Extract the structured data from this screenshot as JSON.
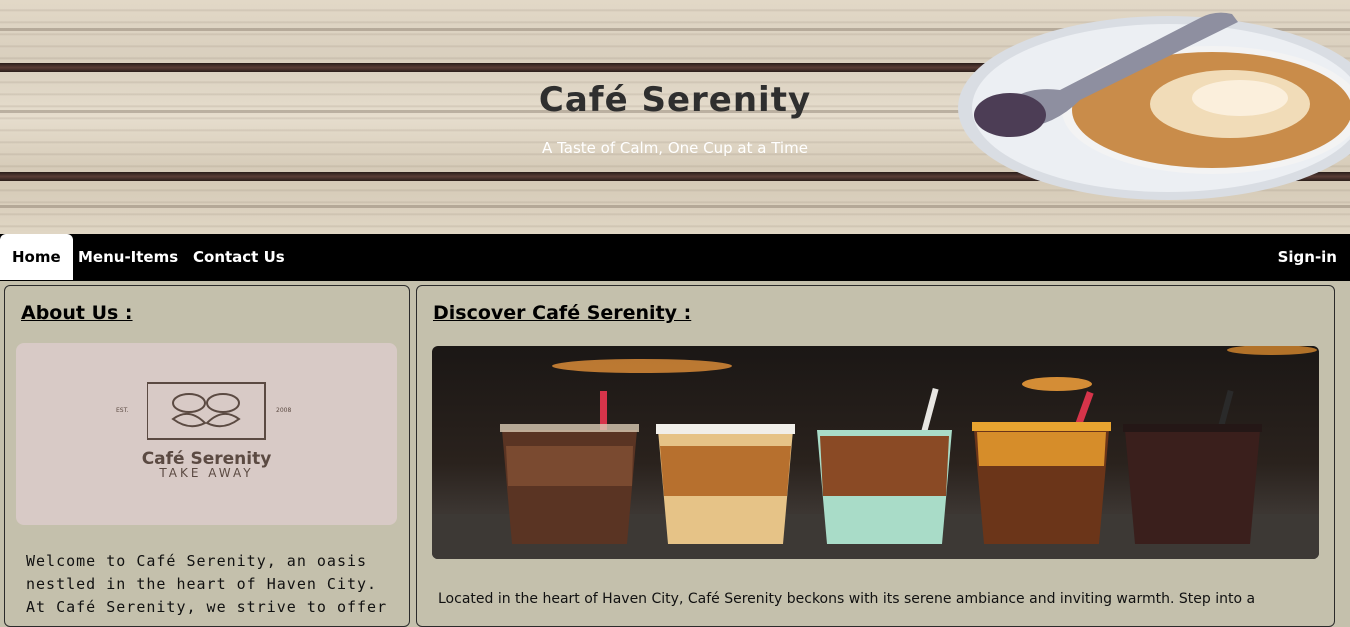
{
  "header": {
    "title": "Café Serenity",
    "tagline": "A Taste of Calm, One Cup at a Time"
  },
  "nav": {
    "items": [
      {
        "label": "Home",
        "active": true
      },
      {
        "label": "Menu-Items",
        "active": false
      },
      {
        "label": "Contact Us",
        "active": false
      }
    ],
    "signin": "Sign-in"
  },
  "about": {
    "heading": "About Us :",
    "logo": {
      "name": "Café Serenity",
      "subtitle": "TAKE AWAY",
      "est": "EST.",
      "year": "2008"
    },
    "text": "Welcome to Café Serenity, an oasis nestled in the heart of Haven City. At Café Serenity, we strive to offer"
  },
  "discover": {
    "heading": "Discover Café Serenity :",
    "text": "Located in the heart of Haven City, Café Serenity beckons with its serene ambiance and inviting warmth. Step into a"
  },
  "colors": {
    "page_bg": "#c4c0ac",
    "nav_bg": "#000000",
    "logo_bg": "#d8cac6",
    "logo_ink": "#5b4a42"
  }
}
